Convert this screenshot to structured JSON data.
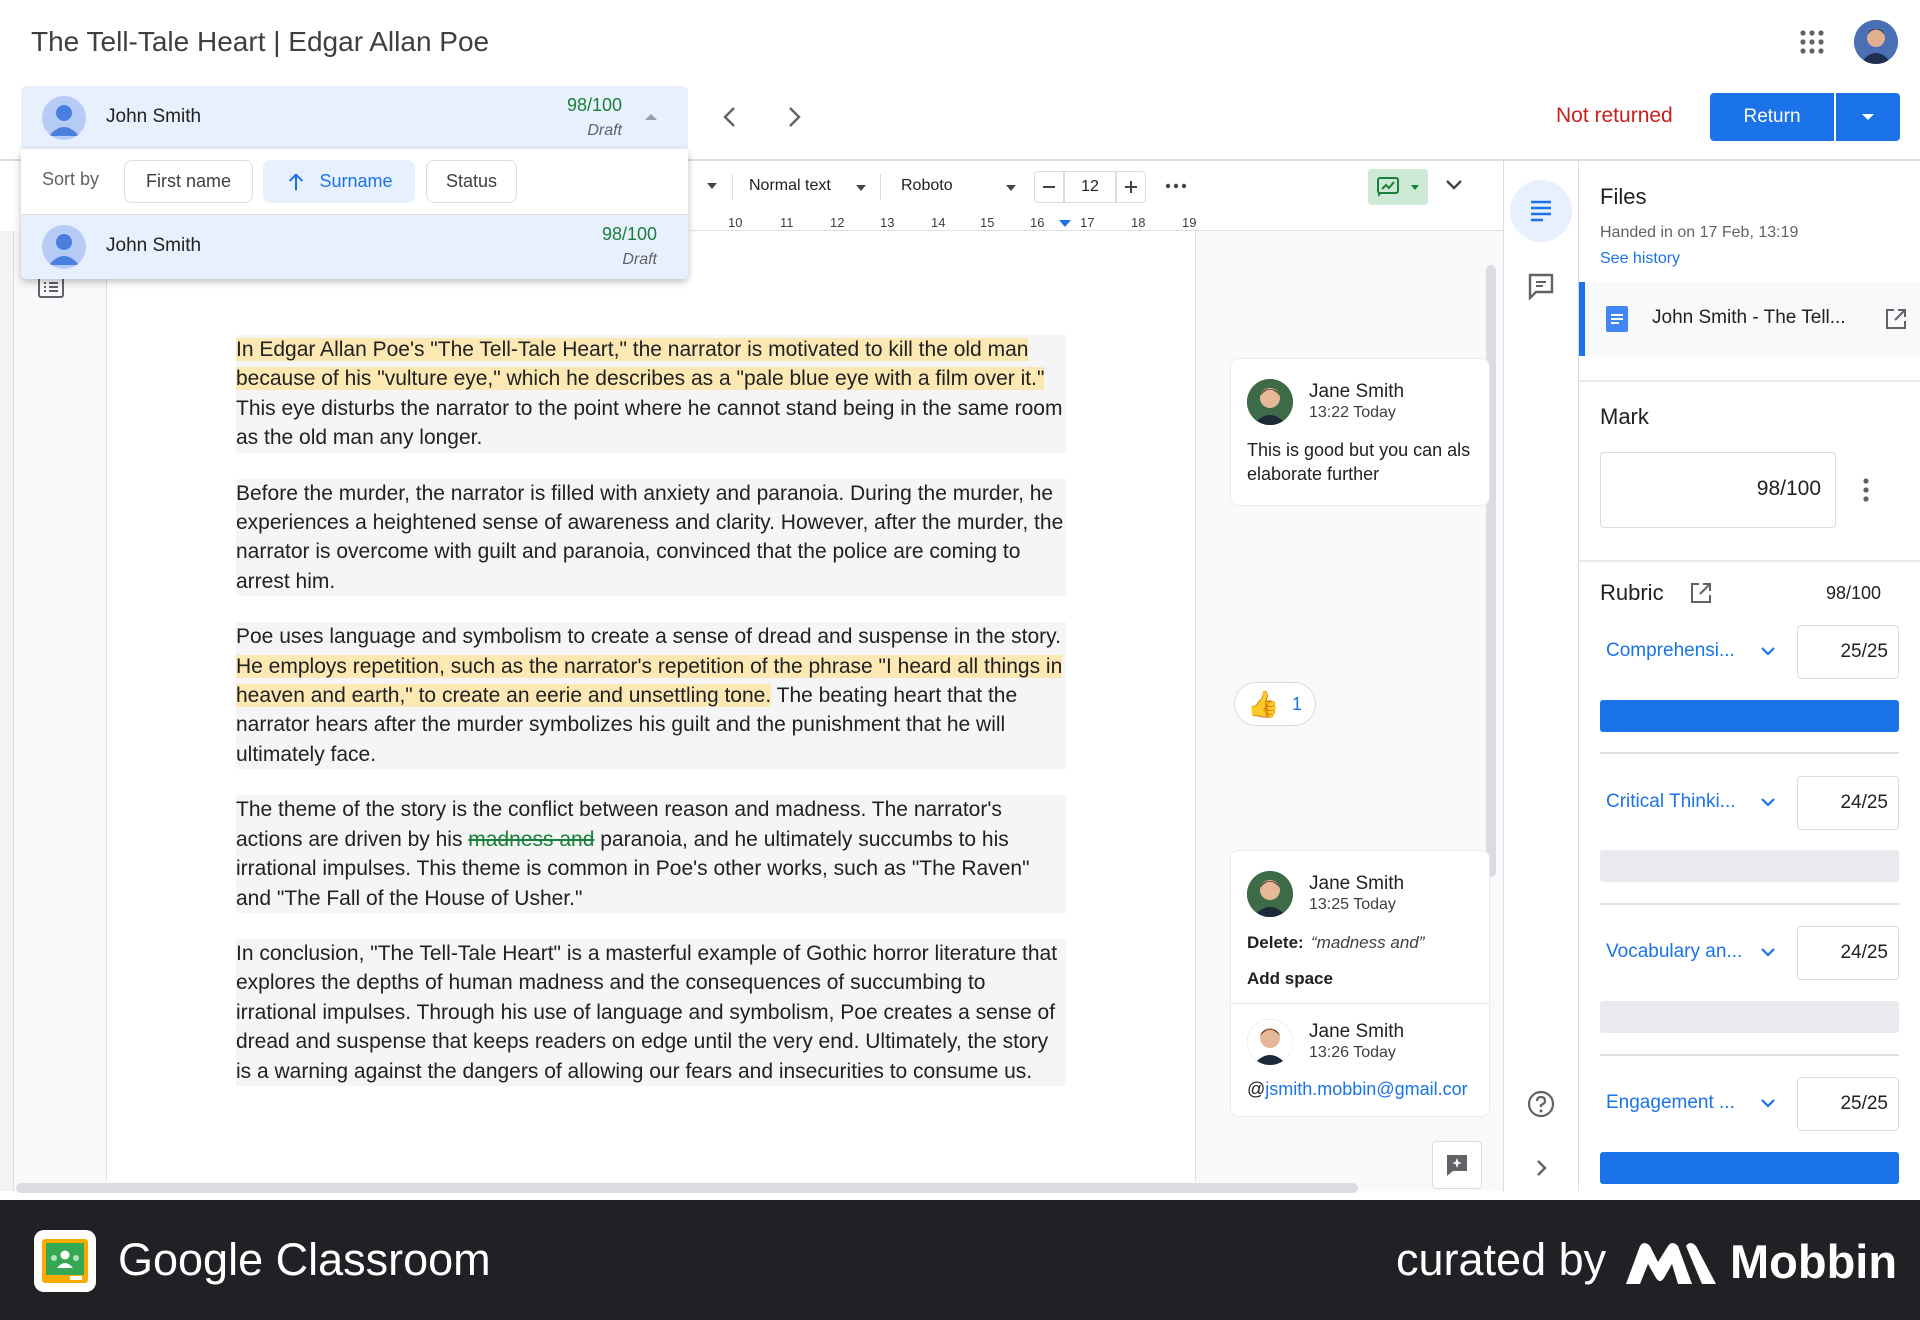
{
  "header": {
    "title": "The Tell-Tale Heart | Edgar Allan Poe"
  },
  "student_selector": {
    "name": "John Smith",
    "grade": "98/100",
    "status": "Draft"
  },
  "sort": {
    "label": "Sort by",
    "options": [
      "First name",
      "Surname",
      "Status"
    ],
    "active": "Surname"
  },
  "dropdown_student": {
    "name": "John Smith",
    "grade": "98/100",
    "status": "Draft"
  },
  "status": {
    "not_returned": "Not returned",
    "return_label": "Return"
  },
  "toolbar": {
    "style": "Normal text",
    "font": "Roboto",
    "font_size": "12",
    "ruler_labels": [
      "10",
      "11",
      "12",
      "13",
      "14",
      "15",
      "16",
      "17",
      "18",
      "19"
    ]
  },
  "document": {
    "p1_hl": "In Edgar Allan Poe's \"The Tell-Tale Heart,\" the narrator is motivated to kill the old man because of his \"vulture eye,\" which he describes as a \"pale blue eye with a film over it.\"",
    "p1_rest": " This eye disturbs the narrator to the point where he cannot stand being in the same room as the old man any longer.",
    "p2": "Before the murder, the narrator is filled with anxiety and paranoia. During the murder, he experiences a heightened sense of awareness and clarity. However, after the murder, the narrator is overcome with guilt and paranoia, convinced that the police are coming to arrest him.",
    "p3_a": "Poe uses language and symbolism to create a sense of dread and suspense in the story. ",
    "p3_hl": "He employs repetition, such as the narrator's repetition of the phrase \"I heard all things in heaven and earth,\" to create an eerie and unsettling tone.",
    "p3_b": " The beating heart that the narrator hears after the murder symbolizes his guilt and the punishment that he will ultimately face.",
    "p4_a": "The theme of the story is the conflict between reason and madness. The narrator's actions are driven by his ",
    "p4_del": "madness and",
    "p4_b": " paranoia, and he ultimately succumbs to his irrational impulses. This theme is common in Poe's other works, such as \"The Raven\" and \"The Fall of the House of Usher.\"",
    "p5": "In conclusion, \"The Tell-Tale Heart\" is a masterful example of Gothic horror literature that explores the depths of human madness and the consequences of succumbing to irrational impulses. Through his use of language and symbolism, Poe creates a sense of dread and suspense that keeps readers on edge until the very end. Ultimately, the story is a warning against the dangers of allowing our fears and insecurities to consume us."
  },
  "comments": [
    {
      "name": "Jane Smith",
      "time": "13:22 Today",
      "line1": "This is good but you can als",
      "line2": "elaborate further"
    },
    {
      "name": "Jane Smith",
      "time": "13:25 Today",
      "delete_label": "Delete:",
      "delete_text": "“madness and”",
      "action": "Add space"
    },
    {
      "name": "Jane Smith",
      "time": "13:26 Today",
      "mention_at": "@",
      "mention": "jsmith.mobbin@gmail.cor"
    }
  ],
  "reaction": {
    "emoji": "👍",
    "count": "1"
  },
  "files": {
    "title": "Files",
    "handed_in": "Handed in on 17 Feb, 13:19",
    "see_history": "See history",
    "file_name": "John Smith - The Tell..."
  },
  "mark": {
    "title": "Mark",
    "value": "98/100"
  },
  "rubric": {
    "title": "Rubric",
    "total": "98/100",
    "criteria": [
      {
        "name": "Comprehensi...",
        "score": "25/25",
        "fill": 1.0
      },
      {
        "name": "Critical Thinki...",
        "score": "24/25",
        "fill": 0
      },
      {
        "name": "Vocabulary an...",
        "score": "24/25",
        "fill": 0
      },
      {
        "name": "Engagement ...",
        "score": "25/25",
        "fill": 1.0
      }
    ]
  },
  "footer": {
    "app": "Google Classroom",
    "curated": "curated by",
    "brand": "Mobbin"
  },
  "colors": {
    "accent": "#1a73e8",
    "highlight": "#fce8b2",
    "grade_green": "#188038",
    "not_returned_red": "#c5221f"
  }
}
